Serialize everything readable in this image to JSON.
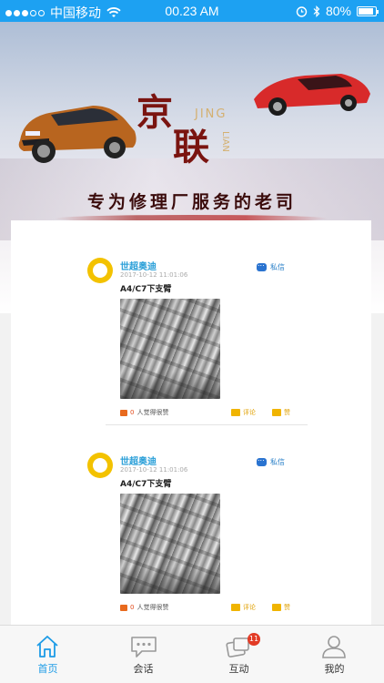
{
  "status_bar": {
    "carrier": "中国移动",
    "time": "00.23 AM",
    "battery": "80%"
  },
  "banner": {
    "logo_char_1": "京",
    "logo_char_2": "联",
    "logo_pinyin_1": "JING",
    "logo_pinyin_2": "LIAN",
    "slogan": "专为修理厂服务的老司"
  },
  "posts": [
    {
      "user": "世超奥迪",
      "time": "2017-10-12 11:01:06",
      "title": "A4/C7下支臂",
      "message_label": "私信",
      "likes_count": "0",
      "likes_suffix": "人觉得很赞",
      "comment_label": "评论",
      "praise_label": "赞"
    },
    {
      "user": "世超奥迪",
      "time": "2017-10-12 11:01:06",
      "title": "A4/C7下支臂",
      "message_label": "私信",
      "likes_count": "0",
      "likes_suffix": "人觉得很赞",
      "comment_label": "评论",
      "praise_label": "赞"
    }
  ],
  "tabbar": {
    "items": [
      {
        "label": "首页",
        "icon": "home-icon",
        "active": true
      },
      {
        "label": "会话",
        "icon": "chat-icon",
        "active": false
      },
      {
        "label": "互动",
        "icon": "interaction-icon",
        "active": false,
        "badge": "11"
      },
      {
        "label": "我的",
        "icon": "profile-icon",
        "active": false
      }
    ]
  },
  "colors": {
    "status_bar": "#1da1f2",
    "accent": "#1c9be6",
    "badge": "#e23b25",
    "username": "#2a9fd8"
  }
}
